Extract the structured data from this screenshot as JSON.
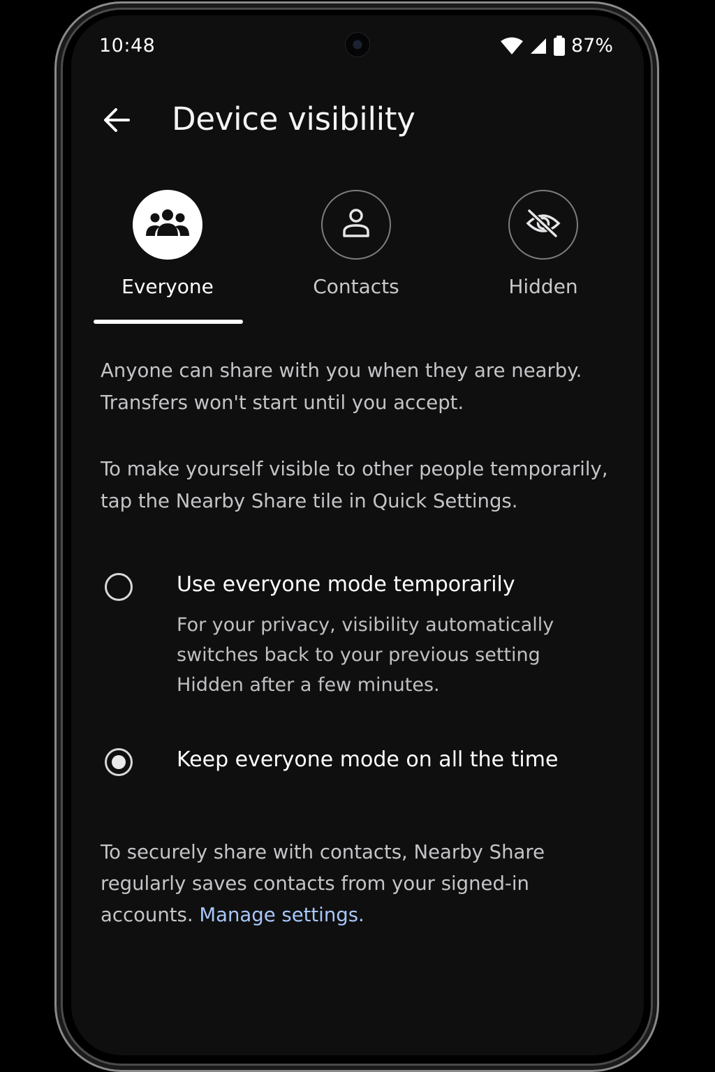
{
  "status_bar": {
    "time": "10:48",
    "battery": "87%",
    "icons": [
      "wifi-icon",
      "cell-signal-icon",
      "battery-icon"
    ]
  },
  "header": {
    "title": "Device visibility",
    "back_icon": "arrow-back-icon"
  },
  "tabs": [
    {
      "label": "Everyone",
      "icon": "group-icon",
      "selected": true
    },
    {
      "label": "Contacts",
      "icon": "person-icon",
      "selected": false
    },
    {
      "label": "Hidden",
      "icon": "visibility-off-icon",
      "selected": false
    }
  ],
  "description": {
    "line1": "Anyone can share with you when they are nearby. Transfers won't start until you accept.",
    "line2": "To make yourself visible to other people temporarily, tap the Nearby Share tile in Quick Settings."
  },
  "options": [
    {
      "title": "Use everyone mode temporarily",
      "description": "For your privacy, visibility automatically switches back to your previous setting Hidden after a few minutes.",
      "checked": false
    },
    {
      "title": "Keep everyone mode on all the time",
      "checked": true
    }
  ],
  "footer": {
    "text": "To securely share with contacts, Nearby Share regularly saves contacts from your signed-in accounts.",
    "link": "Manage settings."
  },
  "colors": {
    "background": "#0f0f10",
    "link": "#a8c7fa",
    "selected": "#ffffff"
  }
}
